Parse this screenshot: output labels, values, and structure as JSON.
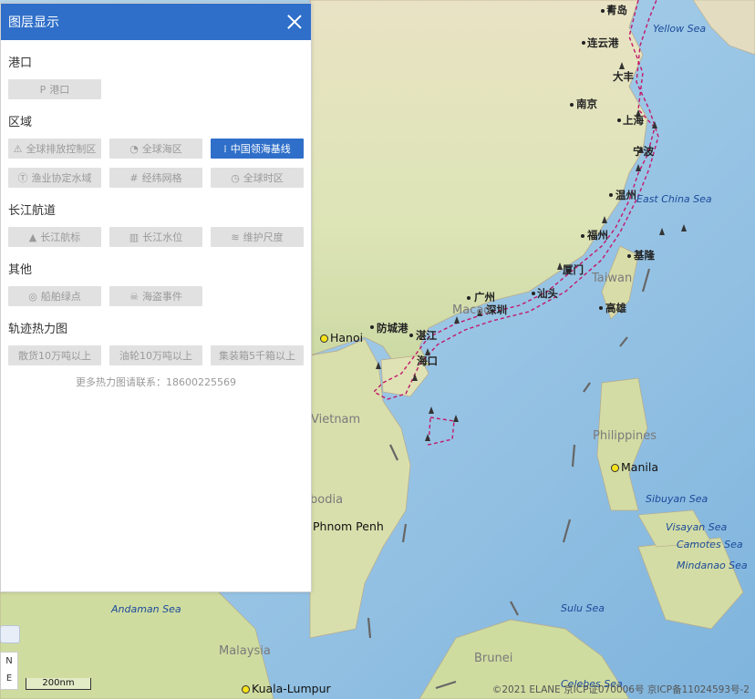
{
  "panel": {
    "title": "图层显示",
    "sections": [
      {
        "title": "港口",
        "buttons": [
          {
            "label": "港口",
            "icon": "P",
            "active": false
          }
        ]
      },
      {
        "title": "区域",
        "buttons": [
          {
            "label": "全球排放控制区",
            "icon": "⚠",
            "active": false
          },
          {
            "label": "全球海区",
            "icon": "◔",
            "active": false
          },
          {
            "label": "中国领海基线",
            "icon": "⁞",
            "active": true
          },
          {
            "label": "渔业协定水域",
            "icon": "Ⓣ",
            "active": false
          },
          {
            "label": "经纬网格",
            "icon": "#",
            "active": false
          },
          {
            "label": "全球时区",
            "icon": "◷",
            "active": false
          }
        ]
      },
      {
        "title": "长江航道",
        "buttons": [
          {
            "label": "长江航标",
            "icon": "▲",
            "active": false
          },
          {
            "label": "长江水位",
            "icon": "▥",
            "active": false
          },
          {
            "label": "维护尺度",
            "icon": "≋",
            "active": false
          }
        ]
      },
      {
        "title": "其他",
        "buttons": [
          {
            "label": "船舶绿点",
            "icon": "◎",
            "active": false
          },
          {
            "label": "海盗事件",
            "icon": "☠",
            "active": false
          }
        ]
      },
      {
        "title": "轨迹热力图",
        "buttons": [
          {
            "label": "散货10万吨以上",
            "icon": "",
            "active": false
          },
          {
            "label": "油轮10万吨以上",
            "icon": "",
            "active": false
          },
          {
            "label": "集装箱5千箱以上",
            "icon": "",
            "active": false
          }
        ]
      }
    ],
    "hint": "更多热力图请联系：18600225569"
  },
  "map": {
    "cities_cn": [
      "青岛",
      "连云港",
      "大丰",
      "南京",
      "上海",
      "宁波",
      "温州",
      "福州",
      "厦门",
      "基隆",
      "高雄",
      "广州",
      "深圳",
      "汕头",
      "防城港",
      "湛江",
      "海口"
    ],
    "cities_en": [
      "Hanoi",
      "Manila",
      "Phnom Penh",
      "Kuala-Lumpur"
    ],
    "countries": [
      "Taiwan",
      "Macao",
      "Vietnam",
      "Philippines",
      "Malaysia",
      "Brunei",
      "bodia"
    ],
    "seas": [
      "Yellow Sea",
      "East China Sea",
      "Sibuyan Sea",
      "Visayan Sea",
      "Camotes Sea",
      "Mindanao Sea",
      "Sulu Sea",
      "Andaman Sea",
      "Celebes Sea"
    ],
    "scale": "200nm",
    "compass": [
      "N",
      "E"
    ],
    "attribution": "©2021 ELANE  京ICP证070006号  京ICP备11024593号-2"
  },
  "colors": {
    "accent": "#2f6fc9",
    "baseline": "#c2186b",
    "sea": "#a9cfe8",
    "land": "#e6e0bf"
  }
}
